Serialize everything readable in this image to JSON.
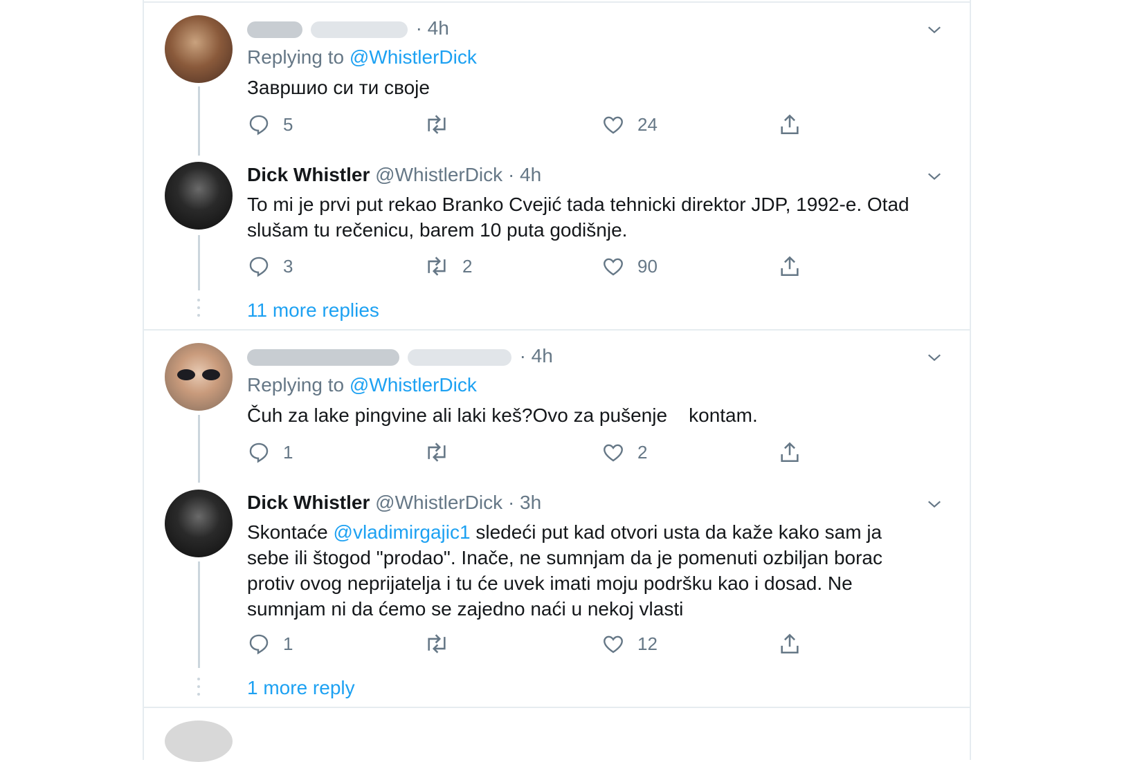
{
  "thread1": {
    "tweet1": {
      "time": "· 4h",
      "replying_prefix": "Replying to ",
      "replying_to": "@WhistlerDick",
      "text": "Завршио си ти своје",
      "reply_count": "5",
      "retweet_count": "",
      "like_count": "24"
    },
    "tweet2": {
      "name": "Dick Whistler",
      "handle": "@WhistlerDick",
      "time": "· 4h",
      "text": "To mi je prvi put rekao Branko Cvejić tada tehnicki direktor JDP,  1992-e. Otad slušam tu rečenicu, barem 10 puta godišnje.",
      "reply_count": "3",
      "retweet_count": "2",
      "like_count": "90"
    },
    "more_replies": "11 more replies"
  },
  "thread2": {
    "tweet1": {
      "time": "· 4h",
      "replying_prefix": "Replying to ",
      "replying_to": "@WhistlerDick",
      "text": "Čuh za lake pingvine ali laki keš?Ovo za pušenje    kontam.",
      "reply_count": "1",
      "retweet_count": "",
      "like_count": "2"
    },
    "tweet2": {
      "name": "Dick Whistler",
      "handle": "@WhistlerDick",
      "time": "· 3h",
      "text_start": "Skontaće ",
      "text_mention": "@vladimirgajic1",
      "text_end": " sledeći put kad otvori usta da kaže kako sam ja sebe ili štogod \"prodao\". Inače, ne sumnjam da je pomenuti ozbiljan borac protiv ovog neprijatelja i tu će uvek imati moju podršku kao i dosad. Ne sumnjam ni da ćemo se zajedno naći u nekoj vlasti",
      "reply_count": "1",
      "retweet_count": "",
      "like_count": "12"
    },
    "more_replies": "1 more reply"
  },
  "colors": {
    "link": "#1da1f2",
    "secondary_text": "#657786",
    "thread_line": "#ccd6dd",
    "border": "#e6ecf0"
  },
  "icons": [
    "reply-icon",
    "retweet-icon",
    "like-icon",
    "share-icon",
    "chevron-down-icon"
  ]
}
